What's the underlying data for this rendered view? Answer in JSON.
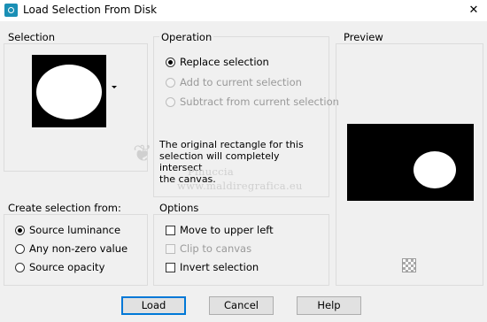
{
  "window": {
    "title": "Load Selection From Disk",
    "close_glyph": "✕"
  },
  "selection": {
    "label": "Selection"
  },
  "operation": {
    "label": "Operation",
    "options": [
      {
        "label": "Replace selection",
        "checked": true,
        "enabled": true
      },
      {
        "label": "Add to current selection",
        "checked": false,
        "enabled": false
      },
      {
        "label": "Subtract from current selection",
        "checked": false,
        "enabled": false
      }
    ],
    "info_lines": [
      "The original rectangle for this",
      "selection will completely intersect",
      "the canvas."
    ]
  },
  "preview": {
    "label": "Preview"
  },
  "create_from": {
    "label": "Create selection from:",
    "options": [
      {
        "label": "Source luminance",
        "checked": true
      },
      {
        "label": "Any non-zero value",
        "checked": false
      },
      {
        "label": "Source opacity",
        "checked": false
      }
    ]
  },
  "options": {
    "label": "Options",
    "items": [
      {
        "label": "Move to upper left",
        "checked": false,
        "enabled": true
      },
      {
        "label": "Clip to canvas",
        "checked": false,
        "enabled": false
      },
      {
        "label": "Invert selection",
        "checked": false,
        "enabled": true
      }
    ]
  },
  "buttons": {
    "load": "Load",
    "cancel": "Cancel",
    "help": "Help"
  },
  "watermark": {
    "line1": "Pinuccia",
    "line2": "www.maldiregrafica.eu"
  },
  "colors": {
    "accent": "#0078d7",
    "disabled_text": "#9a9a9a"
  }
}
